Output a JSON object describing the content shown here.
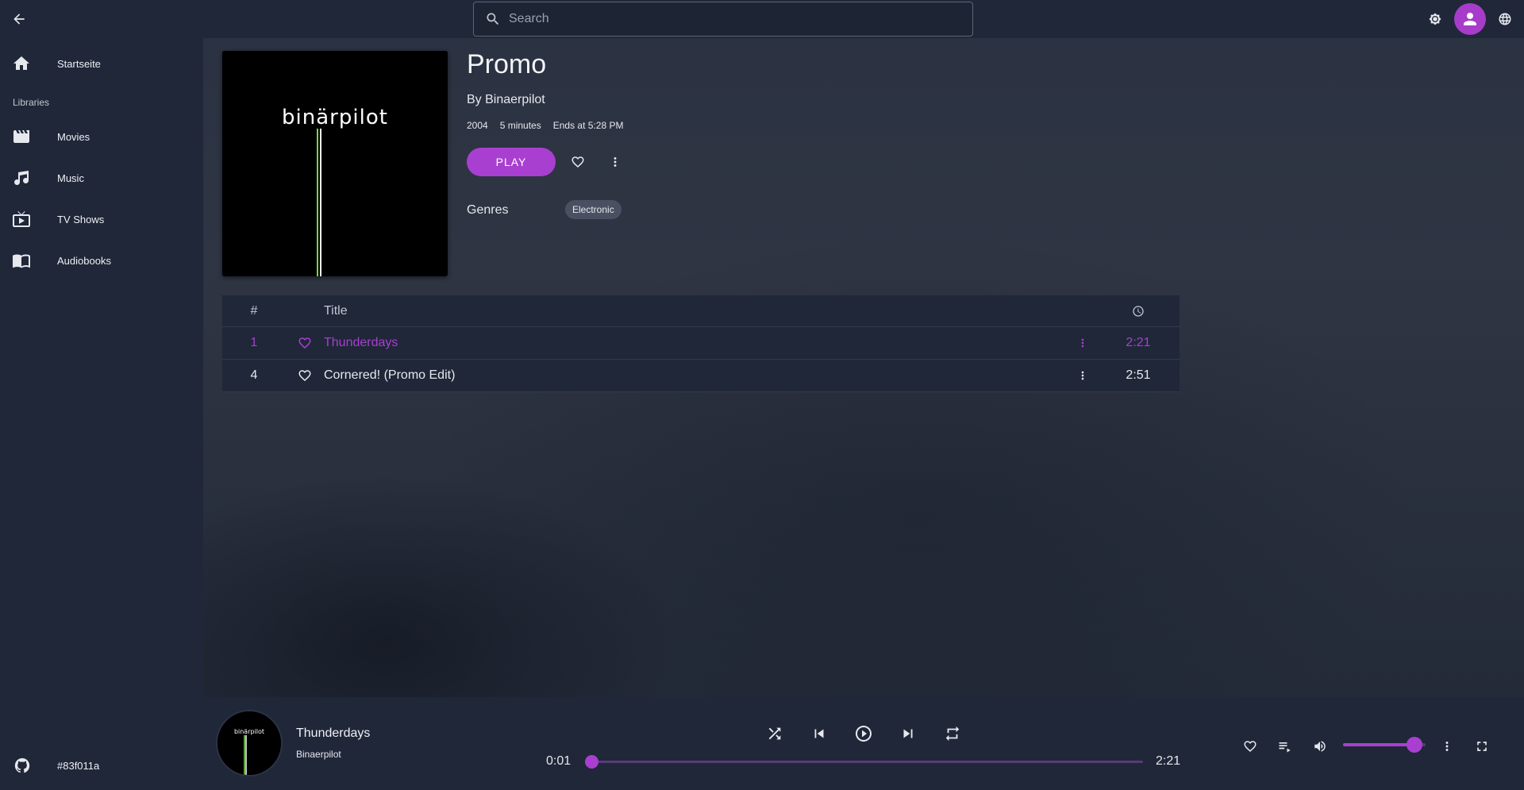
{
  "search": {
    "placeholder": "Search"
  },
  "sidebar": {
    "home_label": "Startseite",
    "section_label": "Libraries",
    "items": [
      {
        "label": "Movies",
        "icon": "movie-icon"
      },
      {
        "label": "Music",
        "icon": "music-note-icon"
      },
      {
        "label": "TV Shows",
        "icon": "tv-icon"
      },
      {
        "label": "Audiobooks",
        "icon": "book-icon"
      }
    ],
    "build_label": "#83f011a"
  },
  "album": {
    "title": "Promo",
    "artist": "By Binaerpilot",
    "year": "2004",
    "runtime": "5 minutes",
    "ends": "Ends at 5:28 PM",
    "play_label": "PLAY",
    "genres_label": "Genres",
    "genres": [
      "Electronic"
    ],
    "cover_text": "binärpilot"
  },
  "tracks": {
    "header": {
      "num": "#",
      "title": "Title"
    },
    "rows": [
      {
        "num": "1",
        "title": "Thunderdays",
        "duration": "2:21",
        "playing": true
      },
      {
        "num": "4",
        "title": "Cornered! (Promo Edit)",
        "duration": "2:51",
        "playing": false
      }
    ]
  },
  "player": {
    "title": "Thunderdays",
    "artist": "Binaerpilot",
    "current_time": "0:01",
    "total_time": "2:21",
    "progress": 0.007,
    "volume": 0.87,
    "cover_text": "binärpilot"
  },
  "colors": {
    "accent": "#a93fd0",
    "background": "#1f2738",
    "text": "#e6e8ee"
  }
}
